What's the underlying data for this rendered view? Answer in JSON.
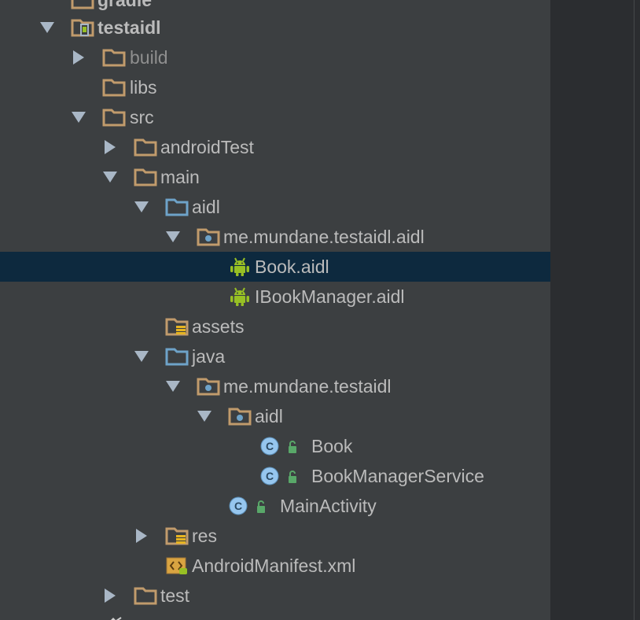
{
  "tree": {
    "items": [
      {
        "label": "gradle",
        "icon": "folder-icon",
        "expanded": false
      },
      {
        "label": "testaidl",
        "icon": "module-icon",
        "expanded": true
      },
      {
        "label": "build",
        "icon": "folder-icon",
        "expanded": false
      },
      {
        "label": "libs",
        "icon": "folder-icon"
      },
      {
        "label": "src",
        "icon": "folder-icon",
        "expanded": true
      },
      {
        "label": "androidTest",
        "icon": "folder-icon",
        "expanded": false
      },
      {
        "label": "main",
        "icon": "folder-icon",
        "expanded": true
      },
      {
        "label": "aidl",
        "icon": "source-folder-icon",
        "expanded": true
      },
      {
        "label": "me.mundane.testaidl.aidl",
        "icon": "package-icon",
        "expanded": true
      },
      {
        "label": "Book.aidl",
        "icon": "android-icon",
        "selected": true
      },
      {
        "label": "IBookManager.aidl",
        "icon": "android-icon"
      },
      {
        "label": "assets",
        "icon": "resource-folder-icon"
      },
      {
        "label": "java",
        "icon": "source-folder-icon",
        "expanded": true
      },
      {
        "label": "me.mundane.testaidl",
        "icon": "package-icon",
        "expanded": true
      },
      {
        "label": "aidl",
        "icon": "package-icon",
        "expanded": true
      },
      {
        "label": "Book",
        "icon": "class-icon"
      },
      {
        "label": "BookManagerService",
        "icon": "class-icon"
      },
      {
        "label": "MainActivity",
        "icon": "class-icon"
      },
      {
        "label": "res",
        "icon": "resource-folder-icon",
        "expanded": false
      },
      {
        "label": "AndroidManifest.xml",
        "icon": "manifest-icon"
      },
      {
        "label": "test",
        "icon": "folder-icon",
        "expanded": false
      },
      {
        "label": "",
        "icon": "script-icon"
      }
    ]
  },
  "colors": {
    "panel_background": "#3c3f41",
    "selection_background": "#0d293e",
    "text": "#bbbbbb",
    "folder_brown": "#c19b6c",
    "folder_blue": "#6ea3c9",
    "android_green": "#97c024",
    "class_blue": "#96c6ee",
    "lock_green": "#59a869"
  }
}
